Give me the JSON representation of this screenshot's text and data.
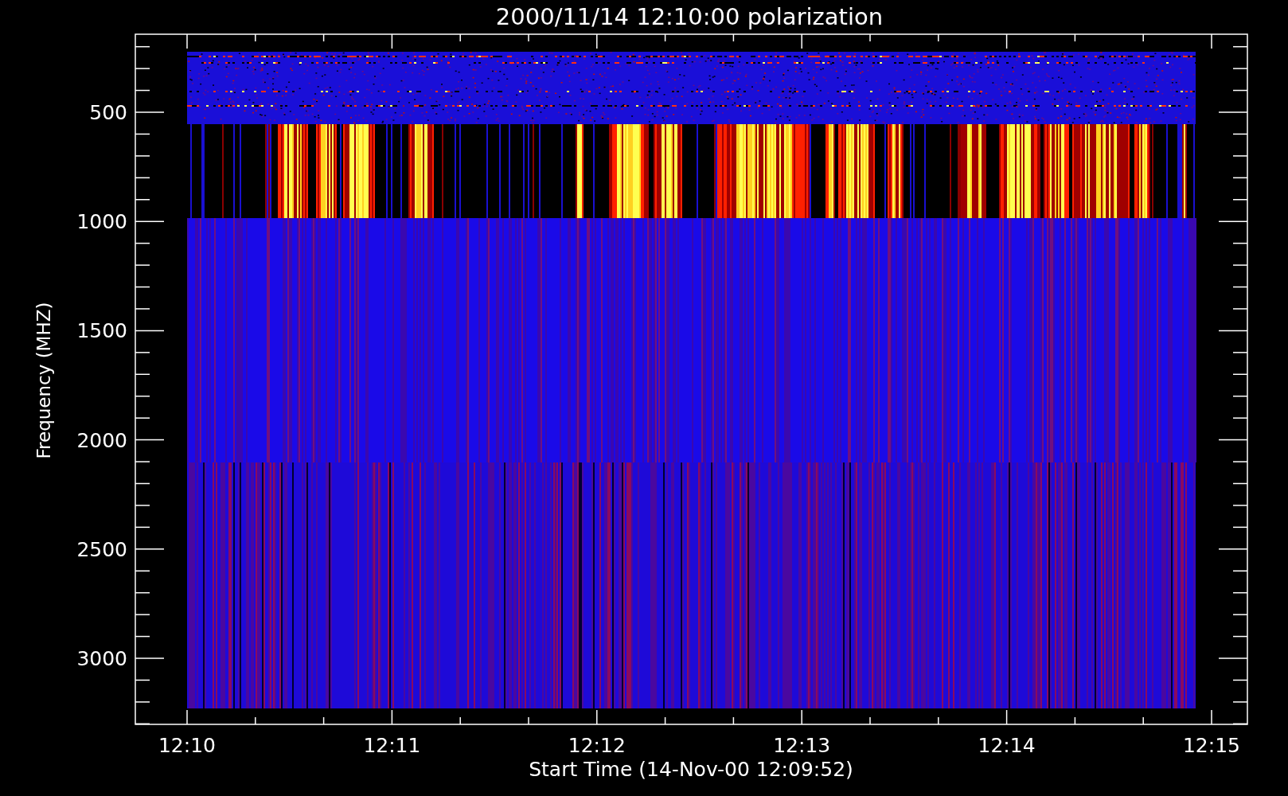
{
  "title": "2000/11/14 12:10:00 polarization",
  "y_axis": {
    "label": "Frequency (MHZ)",
    "ticks": [
      "500",
      "1000",
      "1500",
      "2000",
      "2500",
      "3000"
    ]
  },
  "x_axis": {
    "label": "Start Time (14-Nov-00 12:09:52)",
    "ticks": [
      "12:10",
      "12:11",
      "12:12",
      "12:13",
      "12:14",
      "12:15"
    ]
  }
}
